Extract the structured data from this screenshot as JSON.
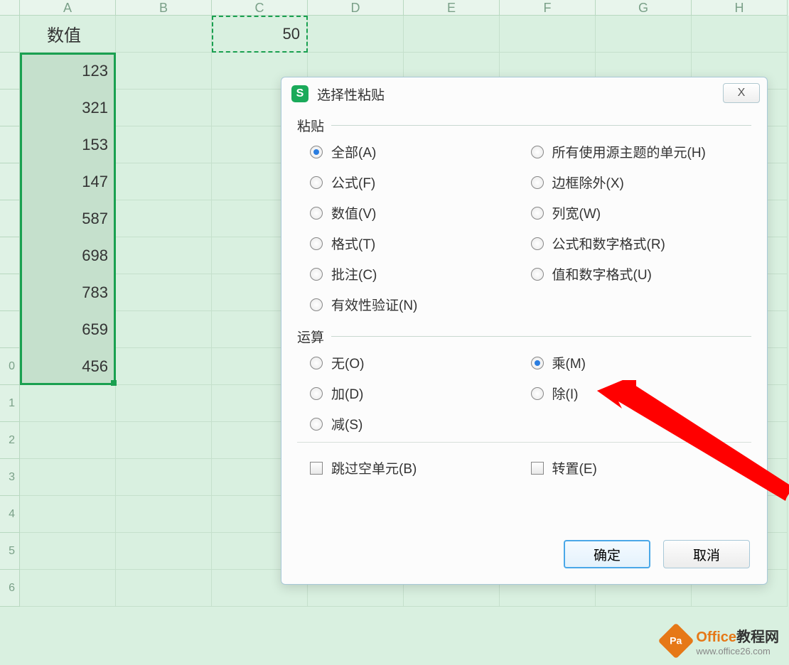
{
  "columns": [
    "A",
    "B",
    "C",
    "D",
    "E",
    "F",
    "G",
    "H"
  ],
  "row_numbers": [
    "",
    "",
    "",
    "",
    "",
    "",
    "",
    "",
    "",
    "0",
    "1",
    "2",
    "3",
    "4",
    "5",
    "6"
  ],
  "sheet": {
    "a1_header": "数值",
    "a_values": [
      123,
      321,
      153,
      147,
      587,
      698,
      783,
      659,
      456
    ],
    "c1_value": 50
  },
  "dialog": {
    "title": "选择性粘贴",
    "close_label": "X",
    "paste_legend": "粘贴",
    "paste_options_left": [
      {
        "label": "全部(A)",
        "checked": true
      },
      {
        "label": "公式(F)",
        "checked": false
      },
      {
        "label": "数值(V)",
        "checked": false
      },
      {
        "label": "格式(T)",
        "checked": false
      },
      {
        "label": "批注(C)",
        "checked": false
      },
      {
        "label": "有效性验证(N)",
        "checked": false
      }
    ],
    "paste_options_right": [
      {
        "label": "所有使用源主题的单元(H)",
        "checked": false
      },
      {
        "label": "边框除外(X)",
        "checked": false
      },
      {
        "label": "列宽(W)",
        "checked": false
      },
      {
        "label": "公式和数字格式(R)",
        "checked": false
      },
      {
        "label": "值和数字格式(U)",
        "checked": false
      }
    ],
    "operation_legend": "运算",
    "op_left": [
      {
        "label": "无(O)",
        "checked": false
      },
      {
        "label": "加(D)",
        "checked": false
      },
      {
        "label": "减(S)",
        "checked": false
      }
    ],
    "op_right": [
      {
        "label": "乘(M)",
        "checked": true
      },
      {
        "label": "除(I)",
        "checked": false
      }
    ],
    "skip_blanks": "跳过空单元(B)",
    "transpose": "转置(E)",
    "ok": "确定",
    "cancel": "取消"
  },
  "watermark": {
    "brand_a": "Office",
    "brand_b": "教程网",
    "url": "www.office26.com",
    "icon_text": "Pa"
  }
}
